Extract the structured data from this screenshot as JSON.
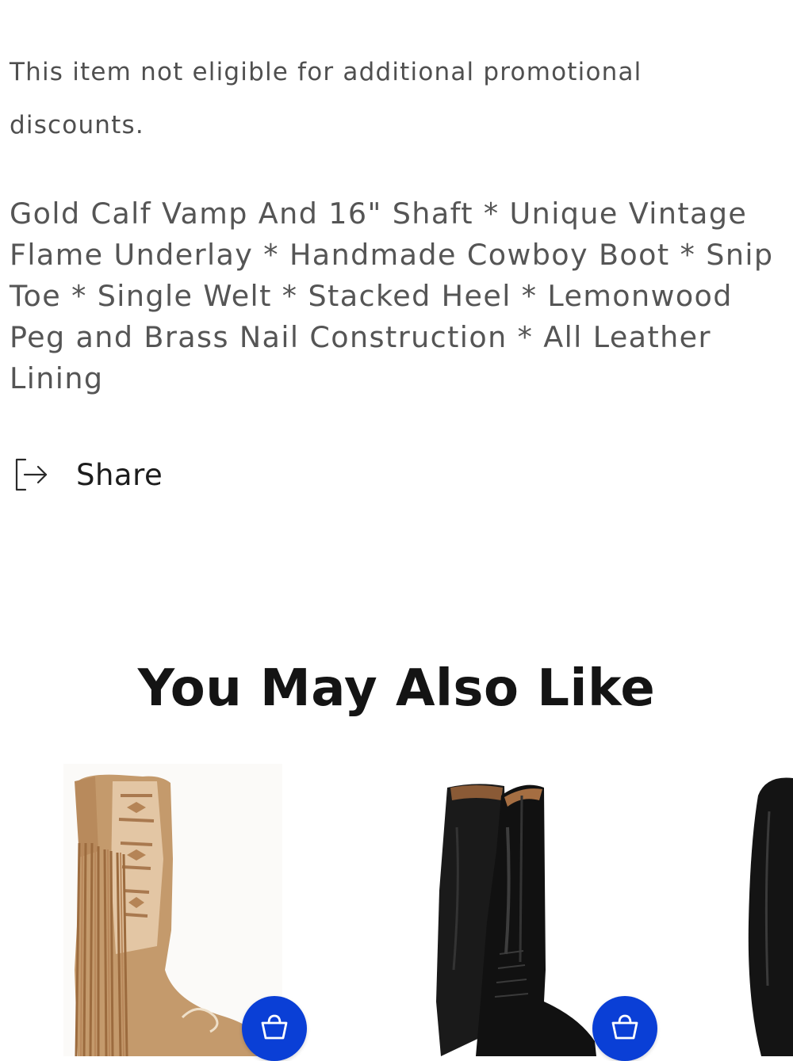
{
  "promo_note": "This item not eligible for additional promotional discounts.",
  "description": "Gold Calf Vamp And 16\" Shaft * Unique Vintage Flame Underlay * Handmade Cowboy Boot * Snip Toe * Single Welt * Stacked Heel * Lemonwood Peg and Brass Nail Construction * All Leather Lining",
  "share": {
    "label": "Share",
    "icon": "share-exit-icon"
  },
  "recommendations": {
    "title": "You May Also Like",
    "products": [
      {
        "image": "tan-fringe-cowboy-boot",
        "cart_icon": "basket-icon"
      },
      {
        "image": "black-tall-riding-boot",
        "cart_icon": "basket-icon"
      },
      {
        "image": "black-tall-boot-partial"
      }
    ]
  },
  "colors": {
    "cart_button": "#0a3fd6",
    "text": "#555555",
    "heading": "#141414"
  }
}
